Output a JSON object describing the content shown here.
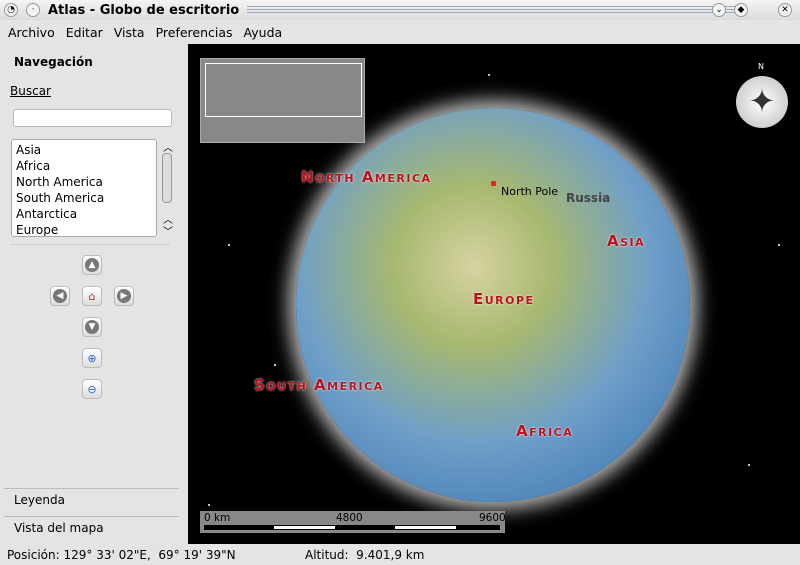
{
  "window": {
    "title": "Atlas - Globo de escritorio"
  },
  "menu": [
    "Archivo",
    "Editar",
    "Vista",
    "Preferencias",
    "Ayuda"
  ],
  "sidebar": {
    "heading": "Navegación",
    "search_label": "Buscar",
    "search_value": "",
    "places": [
      "Asia",
      "Africa",
      "North America",
      "South America",
      "Antarctica",
      "Europe"
    ],
    "tabs": [
      "Leyenda",
      "Vista del mapa"
    ]
  },
  "map": {
    "labels": {
      "north_america": "North America",
      "south_america": "South America",
      "europe": "Europe",
      "asia": "Asia",
      "africa": "Africa",
      "north_pole": "North Pole",
      "russia": "Russia"
    },
    "compass_label": "N",
    "scale": {
      "start": "0 km",
      "mid": "4800",
      "end": "9600"
    }
  },
  "status": {
    "position": "Posición: 129° 33' 02\"E,  69° 19' 39\"N",
    "altitude": "Altitud:  9.401,9 km"
  }
}
